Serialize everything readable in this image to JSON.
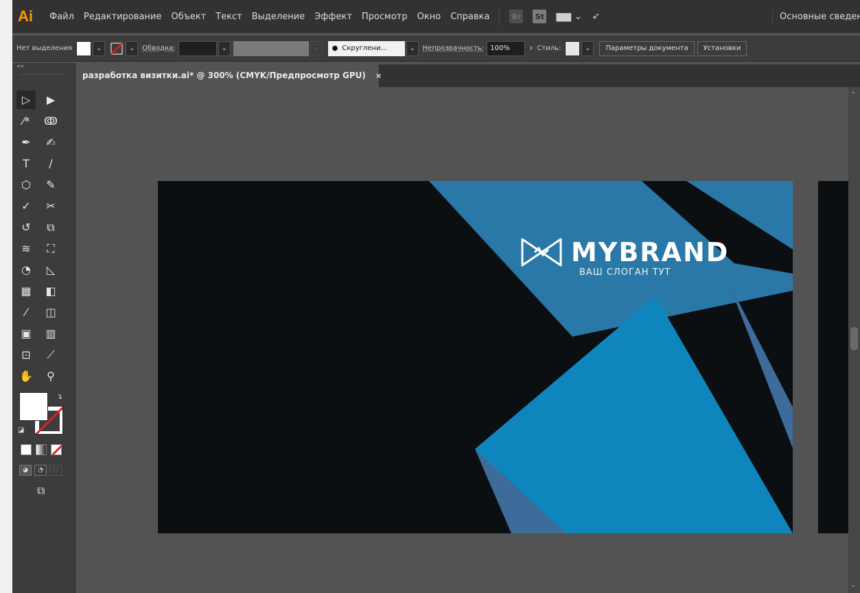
{
  "menubar": {
    "logo": "Ai",
    "items": [
      "Файл",
      "Редактирование",
      "Объект",
      "Текст",
      "Выделение",
      "Эффект",
      "Просмотр",
      "Окно",
      "Справка"
    ],
    "badges": [
      "Br",
      "St"
    ],
    "workspace": "Основные сведения"
  },
  "controlbar": {
    "selection": "Нет выделения",
    "stroke_label": "Обводка:",
    "brush_label": "Скруглени...",
    "opacity_label": "Непрозрачность:",
    "opacity_value": "100%",
    "style_label": "Стиль:",
    "doc_settings": "Параметры документа",
    "preferences": "Установки"
  },
  "tab": {
    "title": "разработка визитки.ai* @ 300% (CMYK/Предпросмотр GPU)",
    "close": "×"
  },
  "toolpanel": {
    "collapse": "««"
  },
  "artboard": {
    "brand": "MYBRAND",
    "slogan": "ВАШ СЛОГАН ТУТ",
    "colors": {
      "dark": "#0b0f12",
      "blue_main": "#0e86bd",
      "blue_light": "#2a78a8",
      "blue_steel": "#3d6b9a"
    }
  }
}
